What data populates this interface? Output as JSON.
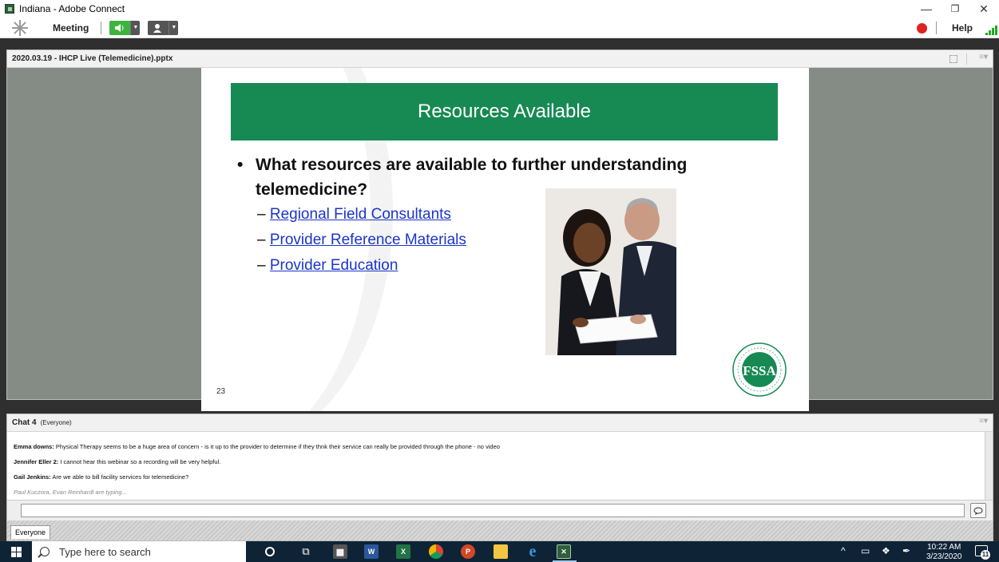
{
  "window": {
    "title": "Indiana - Adobe Connect",
    "minimize": "—",
    "maximize": "❐",
    "close": "✕"
  },
  "menubar": {
    "meeting": "Meeting",
    "help": "Help",
    "speaker_icon": "speaker-icon",
    "camera_icon": "camera-icon"
  },
  "share_pod": {
    "title": "2020.03.19 - IHCP Live (Telemedicine).pptx",
    "menu": "≡▾",
    "slide": {
      "banner": "Resources Available",
      "bullet_dot": "•",
      "bullet": "What resources are available to further understanding telemedicine?",
      "dash": "–",
      "links": [
        "Regional Field Consultants",
        "Provider Reference Materials",
        "Provider Education"
      ],
      "page_number": "23"
    }
  },
  "chat_pod": {
    "title": "Chat 4",
    "scope": "(Everyone)",
    "menu": "≡▾",
    "messages": [
      {
        "name": "Emma downs:",
        "text": " Physical Therapy seems to be a huge area of concern - is it up to the provider to determine if they thnk their service can really be provided through the phone - no video"
      },
      {
        "name": "Jennifer Eller 2:",
        "text": " I cannot hear this webinar so a recording will be very helpful."
      },
      {
        "name": "Gail Jenkins:",
        "text": " Are we able to bill facility services for telemedicine?"
      }
    ],
    "typing": "Paul Kuczora, Evan Reinhardt are typing...",
    "input_value": "",
    "tab": "Everyone"
  },
  "taskbar": {
    "search_placeholder": "Type here to search",
    "time": "10:22 AM",
    "date": "3/23/2020",
    "notifications": "11",
    "icons": [
      "cortana-icon",
      "task-view-icon",
      "calculator-icon",
      "word-icon",
      "excel-icon",
      "chrome-icon",
      "powerpoint-icon",
      "file-explorer-icon",
      "edge-icon",
      "adobe-connect-icon"
    ],
    "tray": {
      "chevron": "^",
      "network": "▭",
      "dropbox": "❖",
      "pen": "✒"
    }
  },
  "colors": {
    "slide_green": "#178a54",
    "link_blue": "#1a35c9",
    "taskbar": "#0f2337",
    "record_red": "#e02222"
  }
}
